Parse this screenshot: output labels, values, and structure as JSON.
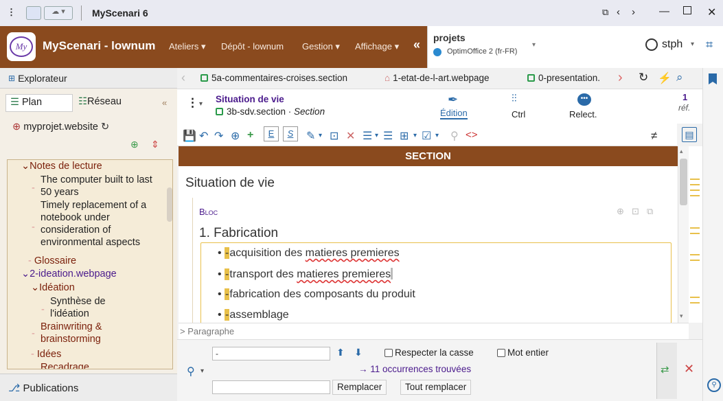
{
  "titlebar": {
    "app_title": "MyScenari 6"
  },
  "header": {
    "app_name": "MyScenari - lownum",
    "menus": [
      "Ateliers ▾",
      "Dépôt - lownum",
      "Gestion ▾",
      "Affichage ▾"
    ],
    "project_label": "projets",
    "project_sub": "OptimOffice 2 (fr-FR)",
    "user": "stph"
  },
  "left": {
    "explorer_title": "Explorateur",
    "tab_plan": "Plan",
    "tab_reseau": "Réseau",
    "root": "myprojet.website",
    "tree": [
      {
        "label": "Notes de lecture",
        "prefix": "⌄"
      },
      {
        "label": "The computer built to last 50 years"
      },
      {
        "label": "Timely replacement of a notebook under consideration of environmental aspects"
      },
      {
        "label": "Glossaire"
      },
      {
        "label": "2-ideation.webpage",
        "prefix": "⌄"
      },
      {
        "label": "Idéation",
        "prefix": "⌄"
      },
      {
        "label": "Synthèse de l'idéation"
      },
      {
        "label": "Brainwriting & brainstorming"
      },
      {
        "label": "Idées"
      },
      {
        "label": "Recadrage"
      }
    ],
    "publications": "Publications"
  },
  "tabs": [
    "5a-commentaires-croises.section",
    "1-etat-de-l-art.webpage",
    "0-presentation."
  ],
  "doc": {
    "title": "Situation de vie",
    "file": "3b-sdv.section",
    "kind": "Section",
    "mode_edition": "Édition",
    "mode_ctrl": "Ctrl",
    "mode_relect": "Relect.",
    "ref_count": "1",
    "ref_label": "réf."
  },
  "section_label": "SECTION",
  "content": {
    "heading": "Situation de vie",
    "bloc_label": "Bloc",
    "subheading": "1. Fabrication",
    "bullets": [
      {
        "mark": "-",
        "text_a": "acquisition des ",
        "text_b": "matieres premieres"
      },
      {
        "mark": "-",
        "text_a": "transport des ",
        "text_b": "matieres premieres"
      },
      {
        "mark": "-",
        "text_a": "fabrication des composants du produit",
        "text_b": ""
      },
      {
        "mark": "-",
        "text_a": "assemblage",
        "text_b": ""
      }
    ]
  },
  "path": "> Paragraphe",
  "find": {
    "search_value": "-",
    "match_case": "Respecter la casse",
    "whole_word": "Mot entier",
    "result": "→ 11 occurrences trouvées",
    "replace_value": "",
    "replace_btn": "Remplacer",
    "replace_all_btn": "Tout remplacer"
  },
  "colors": {
    "brand": "#8a4a1e",
    "highlight": "#e8c04a",
    "accent": "#2a6aa8"
  }
}
